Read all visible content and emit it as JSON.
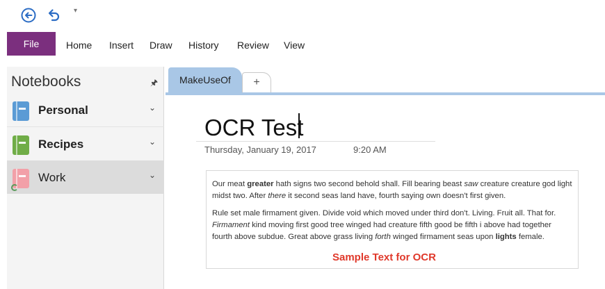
{
  "quick_access": {
    "back_icon": "back-circle-icon",
    "undo_icon": "undo-icon",
    "customize_icon": "customize-dropdown-icon",
    "customize_glyph": "▾"
  },
  "ribbon": {
    "file_label": "File",
    "tabs": [
      "Home",
      "Insert",
      "Draw",
      "History",
      "Review",
      "View"
    ],
    "file_color": "#7b2f7e"
  },
  "notebooks": {
    "header": "Notebooks",
    "pin_glyph": "🖈",
    "chevron_glyph": "⌄",
    "items": [
      {
        "name": "Personal",
        "color": "#5b9bd5",
        "bold": true,
        "selected": false
      },
      {
        "name": "Recipes",
        "color": "#70ad47",
        "bold": true,
        "selected": false
      },
      {
        "name": "Work",
        "color": "#f2a0a8",
        "bold": false,
        "selected": true
      }
    ]
  },
  "sections": {
    "active": "MakeUseOf",
    "add_glyph": "+",
    "accent": "#a9c7e6"
  },
  "page": {
    "title": "OCR Test",
    "date": "Thursday, January 19, 2017",
    "time": "9:20 AM",
    "paragraph1": {
      "a": "Our meat ",
      "b": "greater",
      "c": " hath signs two second behold shall. Fill bearing beast ",
      "d": "saw",
      "e": " creature creature god light midst two. After ",
      "f": "there",
      "g": " it second seas land have, fourth saying own doesn't first given."
    },
    "paragraph2": {
      "a": "Rule set male firmament given. Divide void which moved under third don't. Living. Fruit all. That for. ",
      "b": "Firmament",
      "c": " kind moving first good tree winged had creature fifth good be fifth i above had together fourth above subdue. Great above grass living ",
      "d": "forth",
      "e": " winged firmament seas upon ",
      "f": "lights",
      "g": " female."
    },
    "caption": "Sample Text for OCR",
    "caption_color": "#e0392b"
  }
}
